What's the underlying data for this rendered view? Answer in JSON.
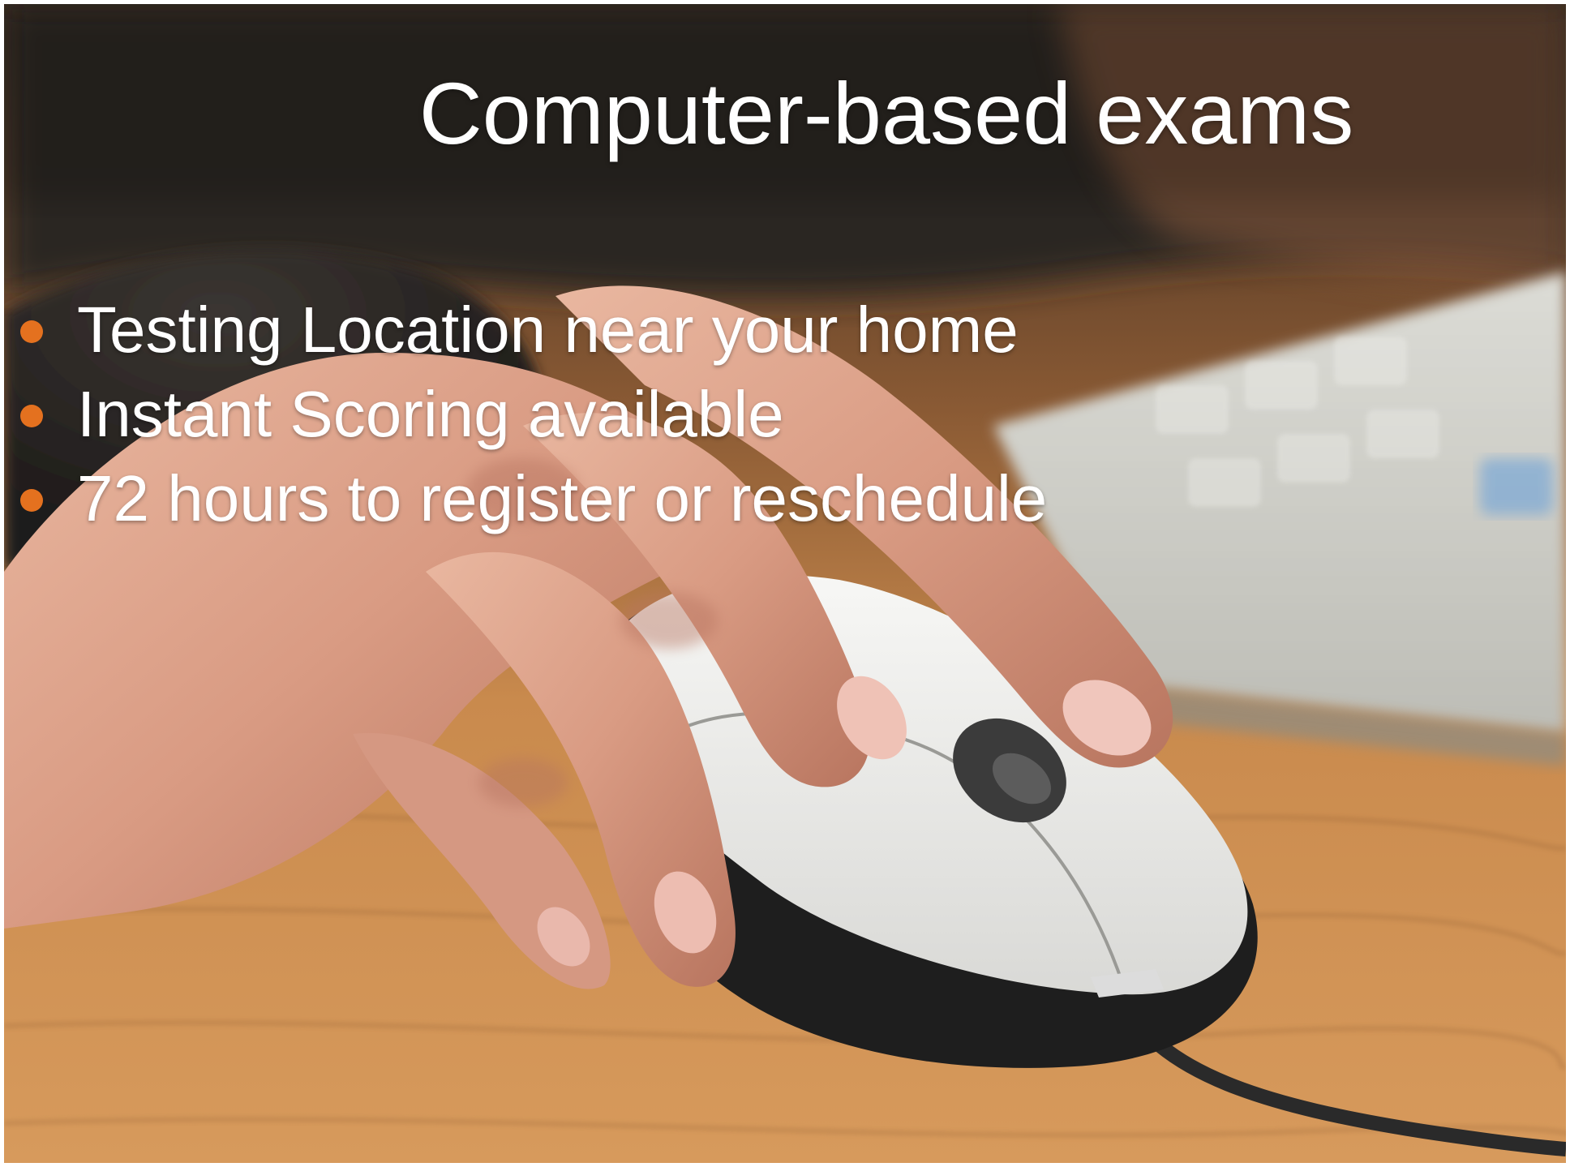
{
  "slide": {
    "title": "Computer-based exams",
    "bullets": [
      "Testing Location near your home",
      "Instant Scoring available",
      "72 hours to register or reschedule"
    ],
    "bullet_color": "#e4711f",
    "text_color": "#ffffff",
    "background_image": "hand-on-computer-mouse-photo"
  }
}
